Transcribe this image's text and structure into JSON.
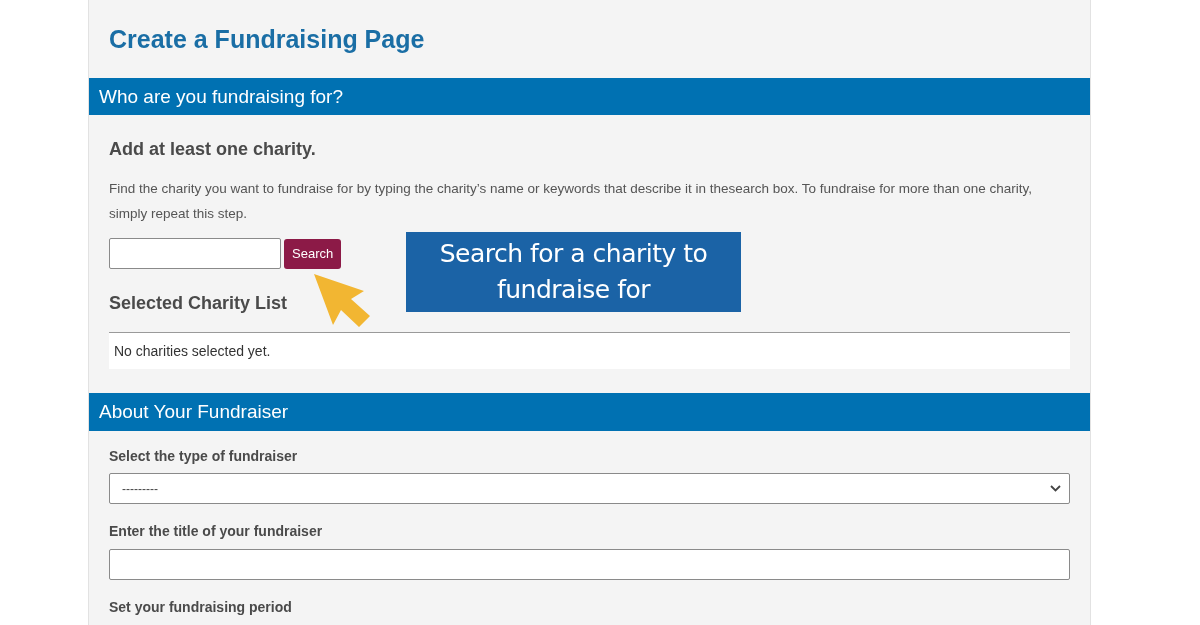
{
  "page": {
    "title": "Create a Fundraising Page"
  },
  "charity_section": {
    "heading": "Who are you fundraising for?",
    "subheading": "Add at least one charity.",
    "instructions": "Find the charity you want to fundraise for by typing the charity’s name or keywords that describe it in thesearch box. To fundraise for more than one charity, simply repeat this step.",
    "search_button": "Search",
    "selected_list": {
      "heading": "Selected Charity List",
      "empty_message": "No charities selected yet."
    }
  },
  "fundraiser_section": {
    "heading": "About Your Fundraiser",
    "fields": [
      {
        "kind": "select",
        "label": "Select the type of fundraiser",
        "value": "---------"
      },
      {
        "kind": "text",
        "label": "Enter the title of your fundraiser"
      },
      {
        "kind": "period",
        "label": "Set your fundraising period"
      }
    ]
  },
  "callout": {
    "text": "Search for a charity to fundraise for"
  }
}
